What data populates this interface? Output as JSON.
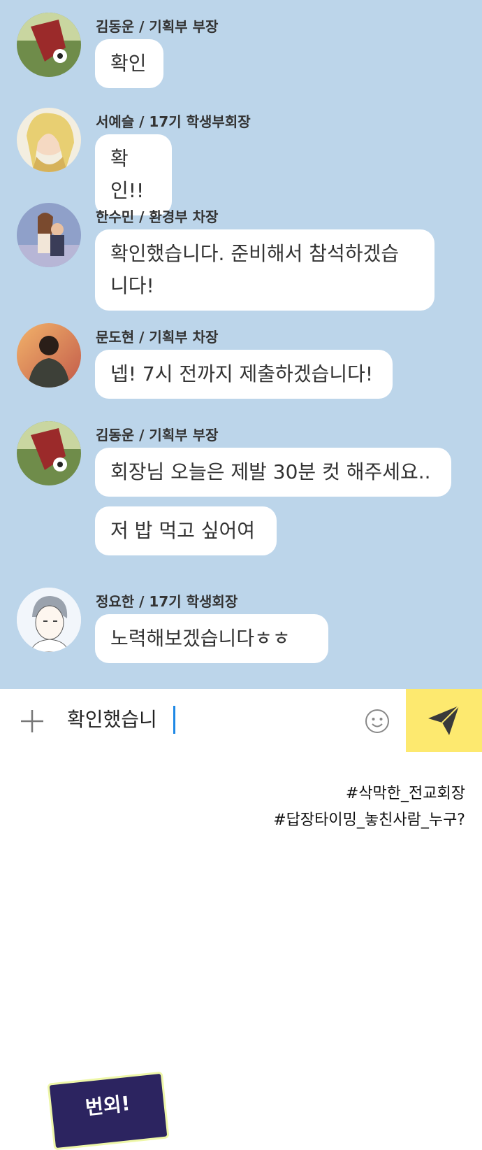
{
  "messages": [
    {
      "sender": "김동운 / 기획부 부장",
      "texts": [
        "확인"
      ],
      "avatar": "soccer-avatar"
    },
    {
      "sender": "서예슬 / 17기 학생부회장",
      "texts": [
        "확인!!"
      ],
      "avatar": "blonde-girl-avatar"
    },
    {
      "sender": "한수민 / 환경부 차장",
      "texts": [
        "확인했습니다. 준비해서 참석하겠습\n니다!"
      ],
      "avatar": "couple-avatar"
    },
    {
      "sender": "문도현 / 기획부 차장",
      "texts": [
        "넵! 7시 전까지 제출하겠습니다!"
      ],
      "avatar": "sunset-person-avatar"
    },
    {
      "sender": "김동운 / 기획부 부장",
      "texts": [
        "회장님 오늘은 제발 30분 컷 해주세요..",
        "저 밥 먹고 싶어여"
      ],
      "avatar": "soccer-avatar"
    },
    {
      "sender": "정요한 / 17기 학생회장",
      "texts": [
        "노력해보겠습니다ㅎㅎ"
      ],
      "avatar": "boy-sketch-avatar"
    }
  ],
  "input": {
    "value": "확인했습니"
  },
  "icons": {
    "plus": "plus-icon",
    "emoji": "emoji-icon",
    "send": "send-icon"
  },
  "hashtags": [
    "#삭막한_전교회장",
    "#답장타이밍_놓친사람_누구?"
  ],
  "sticker": {
    "label": "번외!"
  },
  "colors": {
    "chat_bg": "#bcd5ea",
    "send_bg": "#fde96f",
    "caret": "#1e88e5"
  }
}
